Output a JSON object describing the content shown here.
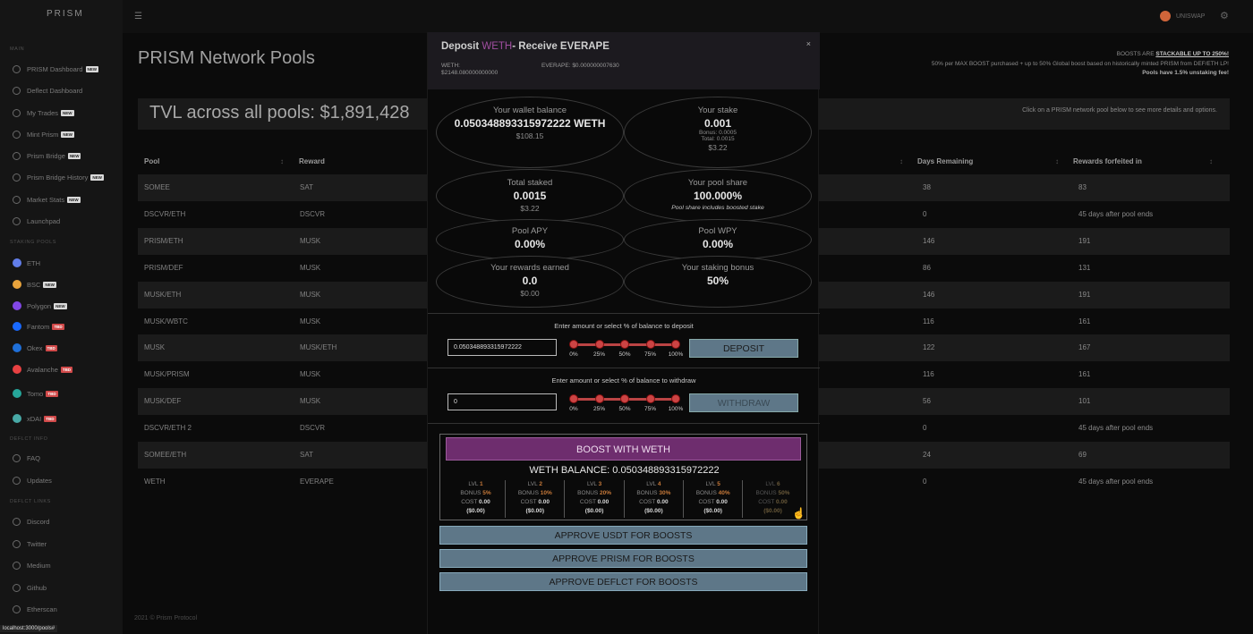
{
  "app": {
    "logo": "PRISM",
    "status_url": "localhost:3000/pools#",
    "footer": "2021 © Prism Protocol"
  },
  "topbar": {
    "wallet_label": "UNISWAP"
  },
  "sidebar": {
    "sections": [
      {
        "title": "MAIN",
        "items": [
          {
            "label": "PRISM Dashboard",
            "badge": "NEW"
          },
          {
            "label": "Deflect Dashboard",
            "badge": ""
          },
          {
            "label": "My Trades",
            "badge": "NEW"
          },
          {
            "label": "Mint Prism",
            "badge": "NEW"
          },
          {
            "label": "Prism Bridge",
            "badge": "NEW"
          },
          {
            "label": "Prism Bridge History",
            "badge": "NEW"
          },
          {
            "label": "Market Stats",
            "badge": "NEW"
          },
          {
            "label": "Launchpad",
            "badge": ""
          }
        ]
      },
      {
        "title": "STAKING POOLS",
        "items": [
          {
            "label": "ETH",
            "badge": ""
          },
          {
            "label": "BSC",
            "badge": "NEW"
          },
          {
            "label": "Polygon",
            "badge": "NEW"
          },
          {
            "label": "Fantom",
            "badge": "TBD"
          },
          {
            "label": "Okex",
            "badge": "TBD"
          },
          {
            "label": "Avalanche",
            "badge": "TBD"
          },
          {
            "label": "Tomo",
            "badge": "TBD"
          },
          {
            "label": "xDAI",
            "badge": "TBD"
          }
        ]
      },
      {
        "title": "DEFLCT INFO",
        "items": [
          {
            "label": "FAQ",
            "badge": ""
          },
          {
            "label": "Updates",
            "badge": ""
          }
        ]
      },
      {
        "title": "DEFLCT LINKS",
        "items": [
          {
            "label": "Discord",
            "badge": ""
          },
          {
            "label": "Twitter",
            "badge": ""
          },
          {
            "label": "Medium",
            "badge": ""
          },
          {
            "label": "Github",
            "badge": ""
          },
          {
            "label": "Etherscan",
            "badge": ""
          }
        ]
      }
    ]
  },
  "main": {
    "title": "PRISM Network Pools",
    "tvl": "TVL across all pools: $1,891,428",
    "hint": "Click on a PRISM network pool below to see more details and options.",
    "boost_line1_prefix": "BOOSTS ARE ",
    "boost_line1_link": "STACKABLE UP TO 250%!",
    "boost_line2": "50% per MAX BOOST purchased + up to 50% Global boost based on historically minted PRISM from DEF/ETH LP!",
    "boost_line3": "Pools have 1.5% unstaking fee!",
    "columns": {
      "pool": "Pool",
      "reward": "Reward",
      "days": "Days Remaining",
      "forfeit": "Rewards forfeited in"
    },
    "rows": [
      {
        "pool": "SOMEE",
        "reward": "SAT",
        "days": "38",
        "forfeit": "83"
      },
      {
        "pool": "DSCVR/ETH",
        "reward": "DSCVR",
        "days": "0",
        "forfeit": "45 days after pool ends"
      },
      {
        "pool": "PRISM/ETH",
        "reward": "MUSK",
        "days": "146",
        "forfeit": "191"
      },
      {
        "pool": "PRISM/DEF",
        "reward": "MUSK",
        "days": "86",
        "forfeit": "131"
      },
      {
        "pool": "MUSK/ETH",
        "reward": "MUSK",
        "days": "146",
        "forfeit": "191"
      },
      {
        "pool": "MUSK/WBTC",
        "reward": "MUSK",
        "days": "116",
        "forfeit": "161"
      },
      {
        "pool": "MUSK",
        "reward": "MUSK/ETH",
        "days": "122",
        "forfeit": "167"
      },
      {
        "pool": "MUSK/PRISM",
        "reward": "MUSK",
        "days": "116",
        "forfeit": "161"
      },
      {
        "pool": "MUSK/DEF",
        "reward": "MUSK",
        "days": "56",
        "forfeit": "101"
      },
      {
        "pool": "DSCVR/ETH 2",
        "reward": "DSCVR",
        "days": "0",
        "forfeit": "45 days after pool ends"
      },
      {
        "pool": "SOMEE/ETH",
        "reward": "SAT",
        "days": "24",
        "forfeit": "69"
      },
      {
        "pool": "WETH",
        "reward": "EVERAPE",
        "days": "0",
        "forfeit": "45 days after pool ends"
      }
    ]
  },
  "modal": {
    "title_prefix": "Deposit ",
    "title_token": "WETH",
    "title_suffix": "- Receive EVERAPE",
    "close": "×",
    "weth_label": "WETH:",
    "weth_price": "$2148.080000000000",
    "everape_price": "EVERAPE: $0.000000007630",
    "cards": {
      "wallet": {
        "label": "Your wallet balance",
        "value": "0.050348893315972222 WETH",
        "usd": "$108.15"
      },
      "stake": {
        "label": "Your stake",
        "value": "0.001",
        "bonus": "Bonus: 0.0005",
        "total": "Total: 0.0015",
        "usd": "$3.22"
      },
      "total_staked": {
        "label": "Total staked",
        "value": "0.0015",
        "usd": "$3.22"
      },
      "pool_share": {
        "label": "Your pool share",
        "value": "100.000%",
        "note": "Pool share includes boosted stake"
      },
      "apy": {
        "label": "Pool APY",
        "value": "0.00%"
      },
      "wpy": {
        "label": "Pool WPY",
        "value": "0.00%"
      },
      "rewards": {
        "label": "Your rewards earned",
        "value": "0.0",
        "usd": "$0.00"
      },
      "bonus": {
        "label": "Your staking bonus",
        "value": "50%"
      }
    },
    "deposit": {
      "label": "Enter amount or select % of balance to deposit",
      "value": "0.050348893315972222",
      "button": "DEPOSIT"
    },
    "withdraw": {
      "label": "Enter amount or select % of balance to withdraw",
      "value": "0",
      "button": "WITHDRAW"
    },
    "percents": [
      "0%",
      "25%",
      "50%",
      "75%",
      "100%"
    ],
    "boost": {
      "button": "BOOST WITH WETH",
      "balance": "WETH BALANCE: 0.050348893315972222",
      "levels": [
        {
          "lvl": "LVL",
          "n": "1",
          "bonus_label": "BONUS",
          "bonus": "5%",
          "cost_label": "COST",
          "cost": "0.00",
          "usd": "($0.00)"
        },
        {
          "lvl": "LVL",
          "n": "2",
          "bonus_label": "BONUS",
          "bonus": "10%",
          "cost_label": "COST",
          "cost": "0.00",
          "usd": "($0.00)"
        },
        {
          "lvl": "LVL",
          "n": "3",
          "bonus_label": "BONUS",
          "bonus": "20%",
          "cost_label": "COST",
          "cost": "0.00",
          "usd": "($0.00)"
        },
        {
          "lvl": "LVL",
          "n": "4",
          "bonus_label": "BONUS",
          "bonus": "30%",
          "cost_label": "COST",
          "cost": "0.00",
          "usd": "($0.00)"
        },
        {
          "lvl": "LVL",
          "n": "5",
          "bonus_label": "BONUS",
          "bonus": "40%",
          "cost_label": "COST",
          "cost": "0.00",
          "usd": "($0.00)"
        },
        {
          "lvl": "LVL",
          "n": "6",
          "bonus_label": "BONUS",
          "bonus": "50%",
          "cost_label": "COST",
          "cost": "0.00",
          "usd": "($0.00)"
        }
      ]
    },
    "approve": [
      "APPROVE USDT FOR BOOSTS",
      "APPROVE PRISM FOR BOOSTS",
      "APPROVE DEFLCT FOR BOOSTS"
    ]
  }
}
